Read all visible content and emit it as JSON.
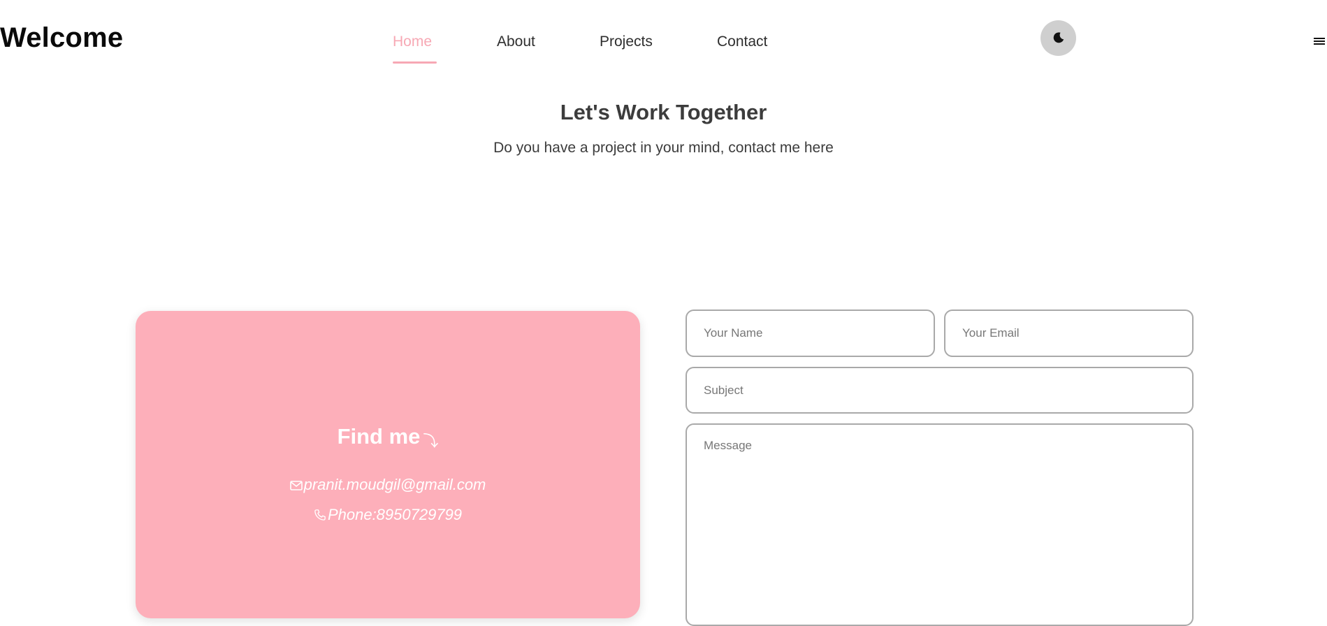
{
  "header": {
    "brand": "Welcome",
    "nav": [
      {
        "label": "Home",
        "active": true
      },
      {
        "label": "About",
        "active": false
      },
      {
        "label": "Projects",
        "active": false
      },
      {
        "label": "Contact",
        "active": false
      }
    ],
    "theme_toggle_icon": "moon-icon",
    "menu_icon": "hamburger-menu-icon"
  },
  "intro": {
    "title": "Let's Work Together",
    "subtitle": "Do you have a project in your mind, contact me here"
  },
  "find_card": {
    "title": "Find me",
    "title_icon": "curved-arrow-down-icon",
    "email": "pranit.moudgil@gmail.com",
    "email_icon": "mail-icon",
    "phone": "Phone:8950729799",
    "phone_icon": "phone-icon"
  },
  "form": {
    "name_placeholder": "Your Name",
    "email_placeholder": "Your Email",
    "subject_placeholder": "Subject",
    "message_placeholder": "Message"
  },
  "colors": {
    "accent": "#f7a8b4",
    "card": "#fdafba",
    "toggle": "#cfcfcf"
  }
}
